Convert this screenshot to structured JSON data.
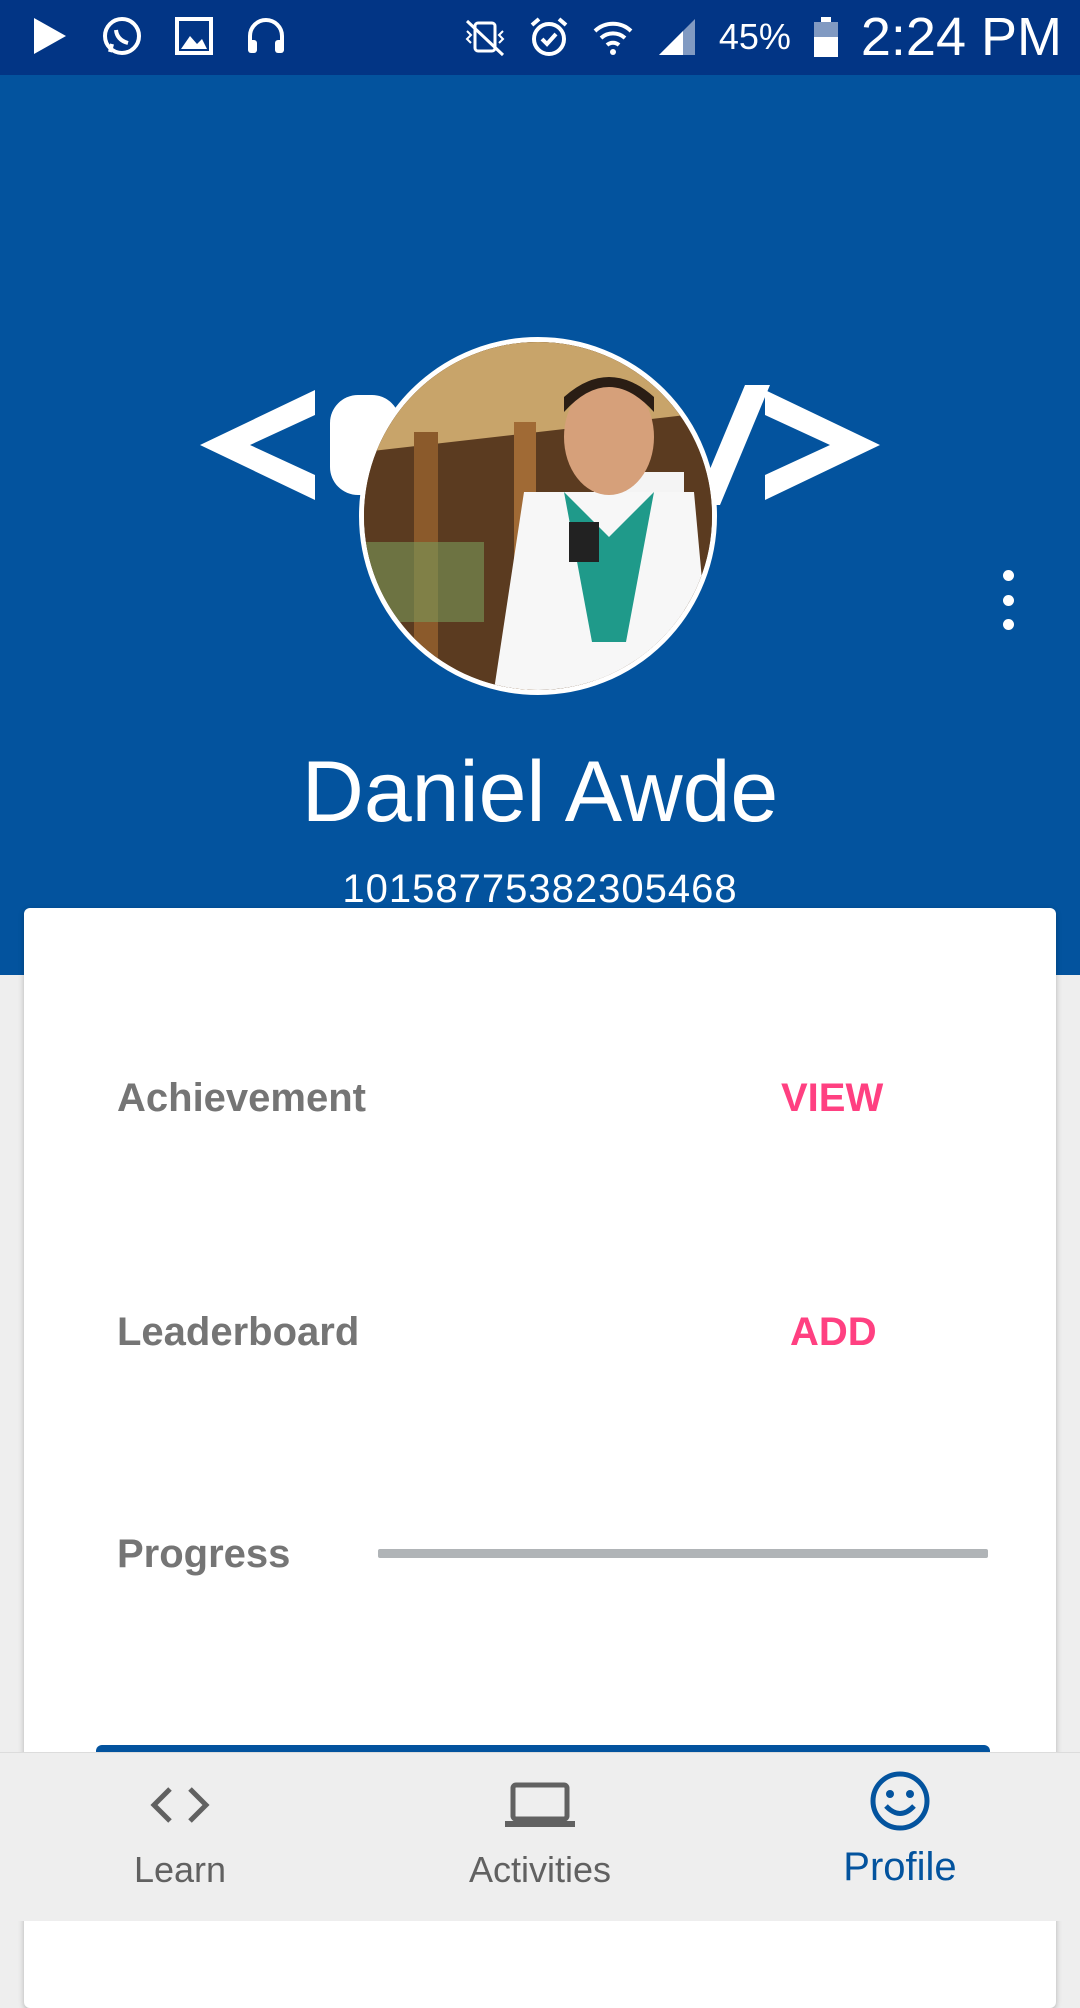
{
  "status_bar": {
    "left_icons": [
      "play-store-icon",
      "whatsapp-icon",
      "gallery-icon",
      "headset-icon"
    ],
    "right_icons": [
      "vibrate-mute-icon",
      "alarm-icon",
      "wifi-icon",
      "signal-icon",
      "battery-icon"
    ],
    "battery_percent": "45%",
    "time": "2:24 PM"
  },
  "profile": {
    "name": "Daniel Awde",
    "id": "10158775382305468",
    "header_color": "#03539e"
  },
  "card": {
    "achievement": {
      "label": "Achievement",
      "action": "VIEW"
    },
    "leaderboard": {
      "label": "Leaderboard",
      "action": "ADD"
    },
    "progress": {
      "label": "Progress",
      "value": 0
    },
    "accent_color": "#ff4081"
  },
  "bottom_nav": {
    "items": [
      {
        "label": "Learn",
        "icon": "code-icon",
        "active": false
      },
      {
        "label": "Activities",
        "icon": "laptop-icon",
        "active": false
      },
      {
        "label": "Profile",
        "icon": "smiley-icon",
        "active": true
      }
    ],
    "active_color": "#03539e"
  }
}
